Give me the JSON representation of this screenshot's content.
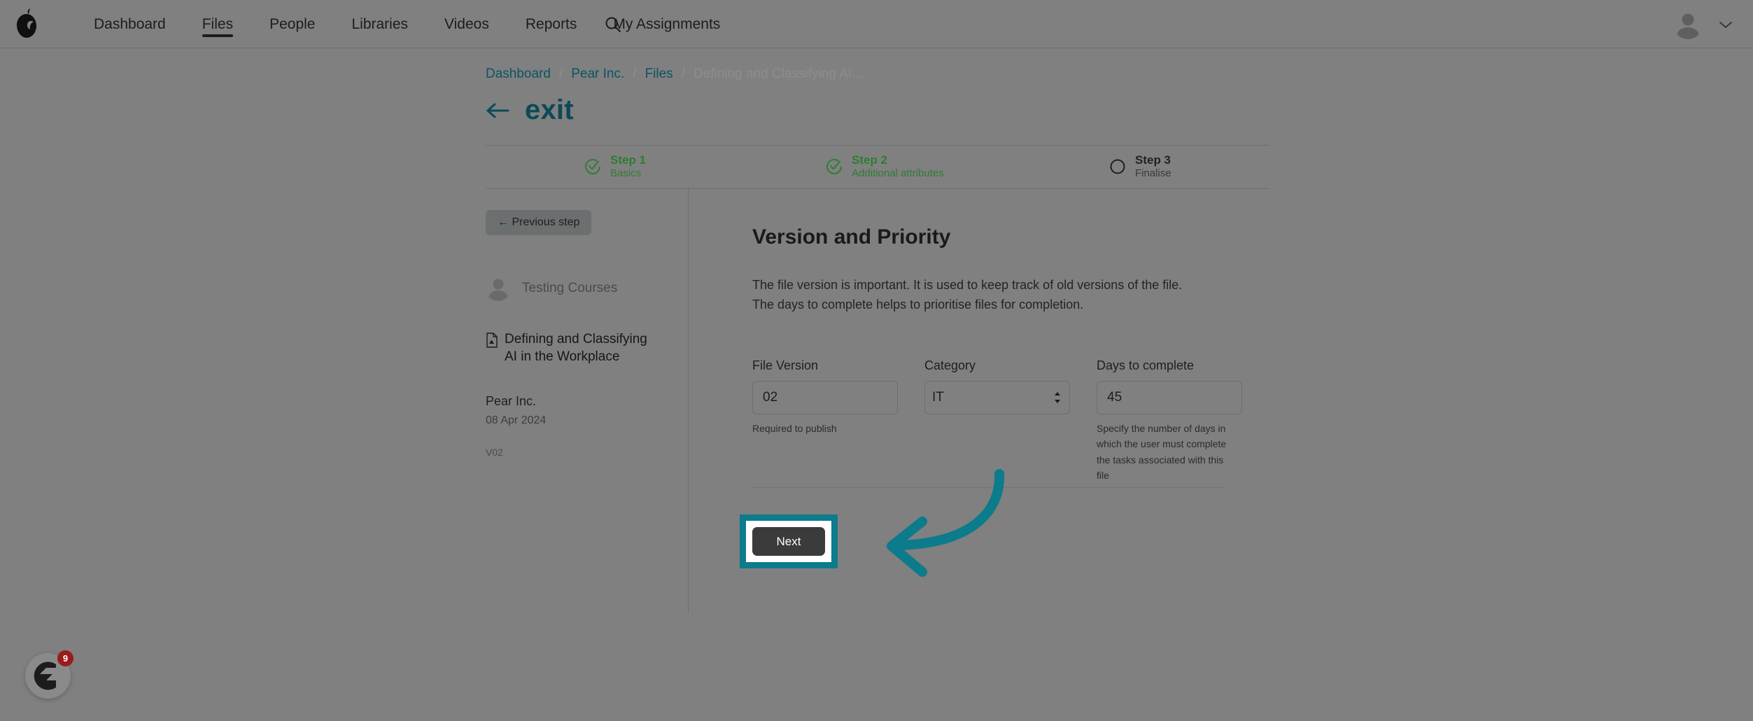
{
  "nav": {
    "logo_icon": "pear-logo-icon",
    "items": [
      {
        "label": "Dashboard",
        "active": false
      },
      {
        "label": "Files",
        "active": true
      },
      {
        "label": "People",
        "active": false
      },
      {
        "label": "Libraries",
        "active": false
      },
      {
        "label": "Videos",
        "active": false
      },
      {
        "label": "Reports",
        "active": false
      },
      {
        "label": "My Assignments",
        "active": false
      }
    ],
    "search_icon": "search-icon",
    "avatar_icon": "user-avatar-icon",
    "chevron_icon": "chevron-down-icon"
  },
  "breadcrumb": {
    "item1": "Dashboard",
    "item2": "Pear Inc.",
    "item3": "Files",
    "current": "Defining and Classifying AI...",
    "separator": "/"
  },
  "header": {
    "back_icon": "back-arrow-icon",
    "title": "exit"
  },
  "stepper": {
    "steps": [
      {
        "name": "Step 1",
        "sub": "Basics",
        "state": "done",
        "icon": "check-circle-icon"
      },
      {
        "name": "Step 2",
        "sub": "Additional attributes",
        "state": "done",
        "icon": "check-circle-icon"
      },
      {
        "name": "Step 3",
        "sub": "Finalise",
        "state": "todo",
        "icon": "empty-circle-icon"
      }
    ]
  },
  "sidebar": {
    "previous_step_label": "← Previous step",
    "owner": {
      "avatar_icon": "user-avatar-icon",
      "name": "Testing Courses"
    },
    "document": {
      "icon": "document-file-icon",
      "title": "Defining and Classifying AI in the Workplace"
    },
    "organisation": "Pear Inc.",
    "date": "08 Apr 2024",
    "version_tag": "V02"
  },
  "main": {
    "title": "Version and Priority",
    "description": "The file version is important. It is used to keep track of old versions of the file. The days to complete helps to prioritise files for completion.",
    "fields": {
      "file_version": {
        "label": "File Version",
        "value": "02",
        "help": "Required to publish"
      },
      "category": {
        "label": "Category",
        "value": "IT",
        "options": [
          "IT"
        ],
        "icon": "select-arrows-icon"
      },
      "days_to_complete": {
        "label": "Days to complete",
        "value": "45",
        "help": "Specify the number of days in which the user must complete the tasks associated with this file"
      }
    },
    "next_label": "Next"
  },
  "annotation": {
    "arrow_icon": "curved-arrow-annotation",
    "color": "#0c7b8c",
    "highlight_target": "next-button"
  },
  "help_widget": {
    "icon": "help-assistant-icon",
    "badge_count": "9",
    "badge_color": "#9b1b1b"
  },
  "colors": {
    "page_overlay": "#808080",
    "teal_accent": "#0c7b8c",
    "breadcrumb_link": "#0c5463",
    "step_done": "#2e7d32",
    "button_dark": "#3b3b3b"
  }
}
